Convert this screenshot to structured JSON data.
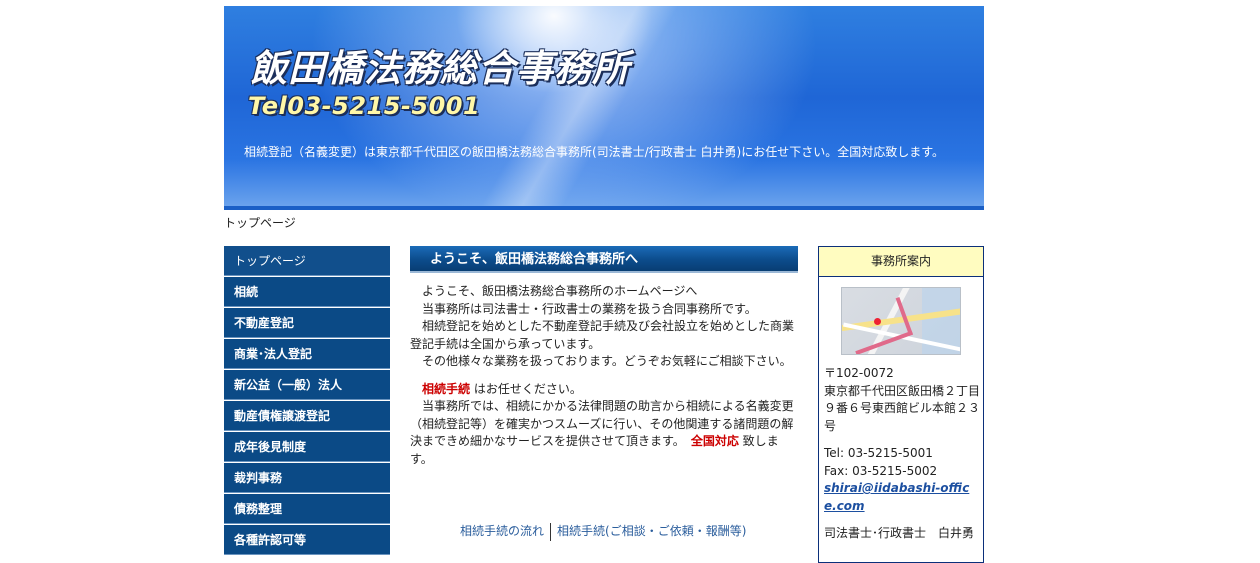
{
  "header": {
    "title": "飯田橋法務総合事務所",
    "tel": "Tel03-5215-5001",
    "description": "相続登記（名義変更）は東京都千代田区の飯田橋法務総合事務所(司法書士/行政書士 白井勇)にお任せ下さい。全国対応致します。"
  },
  "breadcrumb": "トップページ",
  "sidebar": {
    "items": [
      {
        "label": "トップページ"
      },
      {
        "label": "相続"
      },
      {
        "label": "不動産登記"
      },
      {
        "label": "商業･法人登記"
      },
      {
        "label": "新公益（一般）法人"
      },
      {
        "label": "動産債権譲渡登記"
      },
      {
        "label": "成年後見制度"
      },
      {
        "label": "裁判事務"
      },
      {
        "label": "債務整理"
      },
      {
        "label": "各種許認可等"
      }
    ]
  },
  "main": {
    "heading": "ようこそ、飯田橋法務総合事務所へ",
    "p1": "ようこそ、飯田橋法務総合事務所のホームページへ",
    "p2": "当事務所は司法書士・行政書士の業務を扱う合同事務所です。",
    "p3": "相続登記を始めとした不動産登記手続及び会社設立を始めとした商業登記手続は全国から承っています。",
    "p4": "その他様々な業務を扱っております。どうぞお気軽にご相談下さい。",
    "p5_red": "相続手続",
    "p5_rest": " はお任せください。",
    "p6_a": "当事務所では、相続にかかる法律問題の助言から相続による名義変更（相続登記等）を確実かつスムーズに行い、その他関連する諸問題の解決まできめ細かなサービスを提供させて頂きます。　",
    "p6_red": "全国対応",
    "p6_b": " 致します。",
    "links": [
      "相続手続の流れ",
      "相続手続(ご相談・ご依頼・報酬等)"
    ]
  },
  "office": {
    "heading": "事務所案内",
    "postal": "〒102-0072",
    "address": "東京都千代田区飯田橋２丁目９番６号東西館ビル本館２３号",
    "tel": "Tel: 03-5215-5001",
    "fax": "Fax: 03-5215-5002",
    "email": "shirai@iidabashi-office.com",
    "person": "司法書士･行政書士　白井勇"
  }
}
